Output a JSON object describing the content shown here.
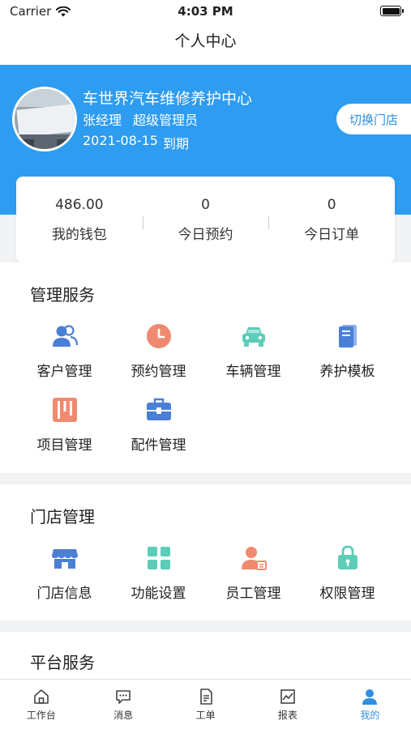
{
  "status_bar": {
    "carrier": "Carrier",
    "time": "4:03 PM"
  },
  "nav": {
    "title": "个人中心"
  },
  "profile": {
    "store_name": "车世界汽车维修养护中心",
    "user_name": "张经理",
    "role": "超级管理员",
    "expire_date": "2021-08-15",
    "expire_label": "到期",
    "switch_button": "切换门店",
    "avatar_sign_text": "车世界汽车维修养护中心"
  },
  "stats": [
    {
      "value": "486.00",
      "label": "我的钱包"
    },
    {
      "value": "0",
      "label": "今日预约"
    },
    {
      "value": "0",
      "label": "今日订单"
    }
  ],
  "management_services": {
    "title": "管理服务",
    "items": [
      {
        "label": "客户管理",
        "icon": "customers-icon",
        "color": "#4a7fd6"
      },
      {
        "label": "预约管理",
        "icon": "clock-icon",
        "color": "#ef8a70"
      },
      {
        "label": "车辆管理",
        "icon": "car-icon",
        "color": "#5ccdb8"
      },
      {
        "label": "养护模板",
        "icon": "book-icon",
        "color": "#4a7fd6"
      },
      {
        "label": "项目管理",
        "icon": "kanban-icon",
        "color": "#ef8a70"
      },
      {
        "label": "配件管理",
        "icon": "toolbox-icon",
        "color": "#4a7fd6"
      }
    ]
  },
  "store_management": {
    "title": "门店管理",
    "items": [
      {
        "label": "门店信息",
        "icon": "storefront-icon",
        "color": "#4a7fd6"
      },
      {
        "label": "功能设置",
        "icon": "grid-icon",
        "color": "#5ccdb8"
      },
      {
        "label": "员工管理",
        "icon": "employee-icon",
        "color": "#ef8a70"
      },
      {
        "label": "权限管理",
        "icon": "lock-icon",
        "color": "#5ccdb8"
      }
    ]
  },
  "platform_services": {
    "title": "平台服务"
  },
  "tab_bar": {
    "active_color": "#2e8fe0",
    "tabs": [
      {
        "label": "工作台",
        "icon": "home-icon"
      },
      {
        "label": "消息",
        "icon": "message-icon"
      },
      {
        "label": "工单",
        "icon": "document-icon"
      },
      {
        "label": "报表",
        "icon": "chart-icon"
      },
      {
        "label": "我的",
        "icon": "user-icon",
        "active": true
      }
    ]
  },
  "colors": {
    "header_blue": "#2e9cf0",
    "accent_blue": "#2e8fe0",
    "page_bg": "#f2f3f5"
  }
}
